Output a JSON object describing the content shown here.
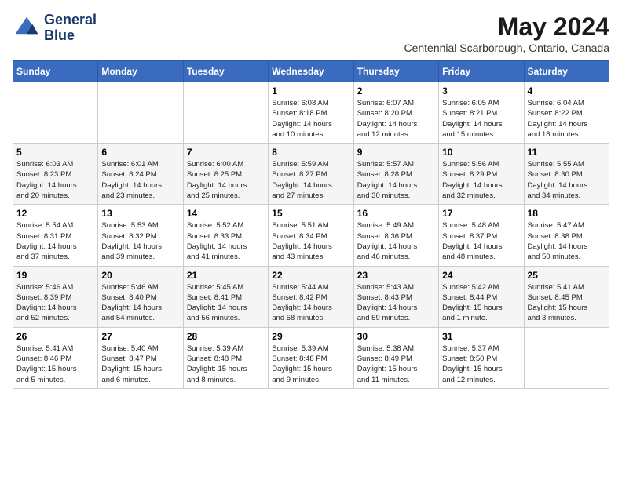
{
  "header": {
    "logo_line1": "General",
    "logo_line2": "Blue",
    "month": "May 2024",
    "location": "Centennial Scarborough, Ontario, Canada"
  },
  "weekdays": [
    "Sunday",
    "Monday",
    "Tuesday",
    "Wednesday",
    "Thursday",
    "Friday",
    "Saturday"
  ],
  "weeks": [
    [
      {
        "day": "",
        "info": ""
      },
      {
        "day": "",
        "info": ""
      },
      {
        "day": "",
        "info": ""
      },
      {
        "day": "1",
        "info": "Sunrise: 6:08 AM\nSunset: 8:18 PM\nDaylight: 14 hours\nand 10 minutes."
      },
      {
        "day": "2",
        "info": "Sunrise: 6:07 AM\nSunset: 8:20 PM\nDaylight: 14 hours\nand 12 minutes."
      },
      {
        "day": "3",
        "info": "Sunrise: 6:05 AM\nSunset: 8:21 PM\nDaylight: 14 hours\nand 15 minutes."
      },
      {
        "day": "4",
        "info": "Sunrise: 6:04 AM\nSunset: 8:22 PM\nDaylight: 14 hours\nand 18 minutes."
      }
    ],
    [
      {
        "day": "5",
        "info": "Sunrise: 6:03 AM\nSunset: 8:23 PM\nDaylight: 14 hours\nand 20 minutes."
      },
      {
        "day": "6",
        "info": "Sunrise: 6:01 AM\nSunset: 8:24 PM\nDaylight: 14 hours\nand 23 minutes."
      },
      {
        "day": "7",
        "info": "Sunrise: 6:00 AM\nSunset: 8:25 PM\nDaylight: 14 hours\nand 25 minutes."
      },
      {
        "day": "8",
        "info": "Sunrise: 5:59 AM\nSunset: 8:27 PM\nDaylight: 14 hours\nand 27 minutes."
      },
      {
        "day": "9",
        "info": "Sunrise: 5:57 AM\nSunset: 8:28 PM\nDaylight: 14 hours\nand 30 minutes."
      },
      {
        "day": "10",
        "info": "Sunrise: 5:56 AM\nSunset: 8:29 PM\nDaylight: 14 hours\nand 32 minutes."
      },
      {
        "day": "11",
        "info": "Sunrise: 5:55 AM\nSunset: 8:30 PM\nDaylight: 14 hours\nand 34 minutes."
      }
    ],
    [
      {
        "day": "12",
        "info": "Sunrise: 5:54 AM\nSunset: 8:31 PM\nDaylight: 14 hours\nand 37 minutes."
      },
      {
        "day": "13",
        "info": "Sunrise: 5:53 AM\nSunset: 8:32 PM\nDaylight: 14 hours\nand 39 minutes."
      },
      {
        "day": "14",
        "info": "Sunrise: 5:52 AM\nSunset: 8:33 PM\nDaylight: 14 hours\nand 41 minutes."
      },
      {
        "day": "15",
        "info": "Sunrise: 5:51 AM\nSunset: 8:34 PM\nDaylight: 14 hours\nand 43 minutes."
      },
      {
        "day": "16",
        "info": "Sunrise: 5:49 AM\nSunset: 8:36 PM\nDaylight: 14 hours\nand 46 minutes."
      },
      {
        "day": "17",
        "info": "Sunrise: 5:48 AM\nSunset: 8:37 PM\nDaylight: 14 hours\nand 48 minutes."
      },
      {
        "day": "18",
        "info": "Sunrise: 5:47 AM\nSunset: 8:38 PM\nDaylight: 14 hours\nand 50 minutes."
      }
    ],
    [
      {
        "day": "19",
        "info": "Sunrise: 5:46 AM\nSunset: 8:39 PM\nDaylight: 14 hours\nand 52 minutes."
      },
      {
        "day": "20",
        "info": "Sunrise: 5:46 AM\nSunset: 8:40 PM\nDaylight: 14 hours\nand 54 minutes."
      },
      {
        "day": "21",
        "info": "Sunrise: 5:45 AM\nSunset: 8:41 PM\nDaylight: 14 hours\nand 56 minutes."
      },
      {
        "day": "22",
        "info": "Sunrise: 5:44 AM\nSunset: 8:42 PM\nDaylight: 14 hours\nand 58 minutes."
      },
      {
        "day": "23",
        "info": "Sunrise: 5:43 AM\nSunset: 8:43 PM\nDaylight: 14 hours\nand 59 minutes."
      },
      {
        "day": "24",
        "info": "Sunrise: 5:42 AM\nSunset: 8:44 PM\nDaylight: 15 hours\nand 1 minute."
      },
      {
        "day": "25",
        "info": "Sunrise: 5:41 AM\nSunset: 8:45 PM\nDaylight: 15 hours\nand 3 minutes."
      }
    ],
    [
      {
        "day": "26",
        "info": "Sunrise: 5:41 AM\nSunset: 8:46 PM\nDaylight: 15 hours\nand 5 minutes."
      },
      {
        "day": "27",
        "info": "Sunrise: 5:40 AM\nSunset: 8:47 PM\nDaylight: 15 hours\nand 6 minutes."
      },
      {
        "day": "28",
        "info": "Sunrise: 5:39 AM\nSunset: 8:48 PM\nDaylight: 15 hours\nand 8 minutes."
      },
      {
        "day": "29",
        "info": "Sunrise: 5:39 AM\nSunset: 8:48 PM\nDaylight: 15 hours\nand 9 minutes."
      },
      {
        "day": "30",
        "info": "Sunrise: 5:38 AM\nSunset: 8:49 PM\nDaylight: 15 hours\nand 11 minutes."
      },
      {
        "day": "31",
        "info": "Sunrise: 5:37 AM\nSunset: 8:50 PM\nDaylight: 15 hours\nand 12 minutes."
      },
      {
        "day": "",
        "info": ""
      }
    ]
  ]
}
